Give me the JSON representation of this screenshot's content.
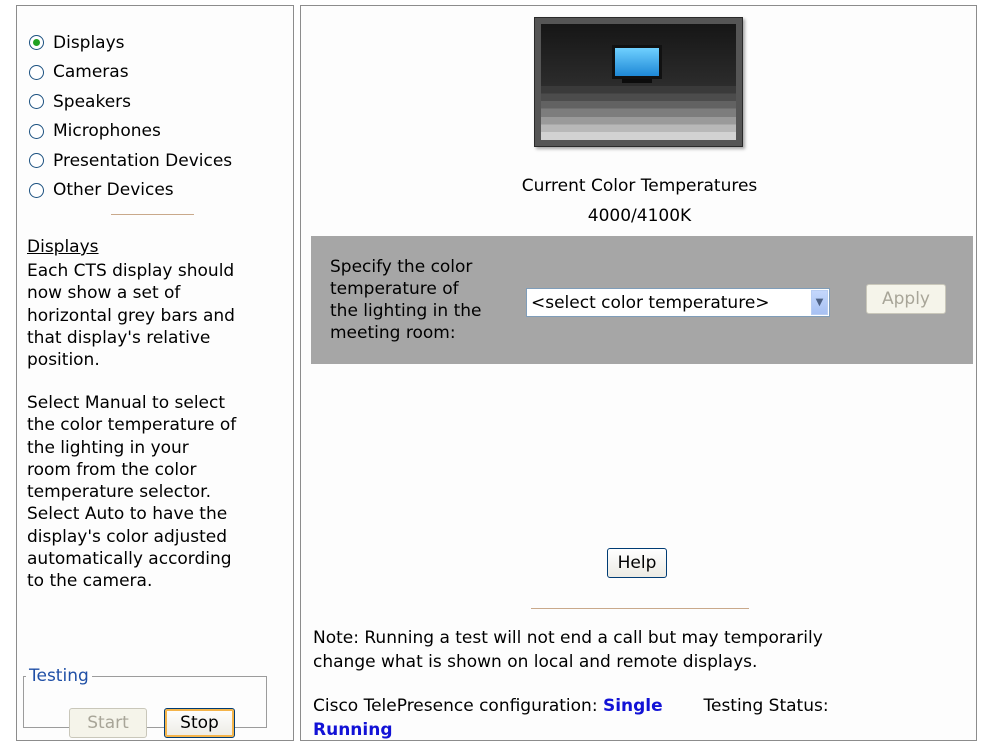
{
  "left": {
    "radio_options": [
      {
        "label": "Displays",
        "checked": true
      },
      {
        "label": "Cameras",
        "checked": false
      },
      {
        "label": "Speakers",
        "checked": false
      },
      {
        "label": "Microphones",
        "checked": false
      },
      {
        "label": "Presentation Devices",
        "checked": false
      },
      {
        "label": "Other Devices",
        "checked": false
      }
    ],
    "help_title": "Displays",
    "help_para1": "Each CTS display should\nnow show a set of\nhorizontal grey bars and\nthat display's relative\nposition.",
    "help_para2": "Select Manual to select\nthe color temperature of\nthe lighting in your\nroom from the color\ntemperature selector.\nSelect Auto to have the\ndisplay's color adjusted\nautomatically according\nto the camera.",
    "testing": {
      "legend": "Testing",
      "start_label": "Start",
      "stop_label": "Stop"
    }
  },
  "main": {
    "color_temp_title": "Current Color Temperatures",
    "color_temp_value": "4000/4100K",
    "prompt": "Specify the color\ntemperature of\nthe lighting in the\nmeeting room:",
    "select_value": "<select color temperature>",
    "apply_label": "Apply",
    "help_label": "Help",
    "note": "Note: Running a test will not end a call but may temporarily\nchange what is shown on local and remote displays.",
    "config_label": "Cisco TelePresence configuration:",
    "config_value": "Single",
    "status_label": "Testing Status:",
    "status_value": "Running"
  },
  "colors": {
    "accent_blue": "#1212d6",
    "radio_selected": "#21a121",
    "grey_box": "#a6a6a6"
  }
}
